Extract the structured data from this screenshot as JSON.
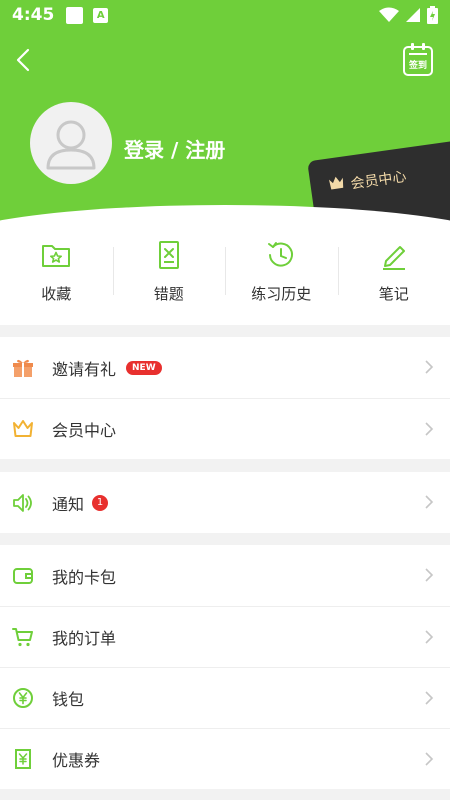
{
  "status_bar": {
    "time": "4:45",
    "notif_icon_letter": "A"
  },
  "header": {
    "bg_color": "#6fcf3a",
    "checkin_label": "签到",
    "login_label": "登录 / 注册",
    "vip_card_label": "会员中心"
  },
  "quick_actions": [
    {
      "label": "收藏",
      "icon": "folder-star-icon"
    },
    {
      "label": "错题",
      "icon": "wrong-question-icon"
    },
    {
      "label": "练习历史",
      "icon": "history-clock-icon"
    },
    {
      "label": "笔记",
      "icon": "pencil-icon"
    }
  ],
  "group1": [
    {
      "label": "邀请有礼",
      "icon": "gift-icon",
      "badge": "NEW"
    },
    {
      "label": "会员中心",
      "icon": "crown-icon"
    }
  ],
  "group2": [
    {
      "label": "通知",
      "icon": "speaker-icon",
      "badge": "1"
    }
  ],
  "group3": [
    {
      "label": "我的卡包",
      "icon": "wallet-icon"
    },
    {
      "label": "我的订单",
      "icon": "cart-icon"
    },
    {
      "label": "钱包",
      "icon": "yuan-icon"
    },
    {
      "label": "优惠券",
      "icon": "coupon-icon"
    }
  ]
}
